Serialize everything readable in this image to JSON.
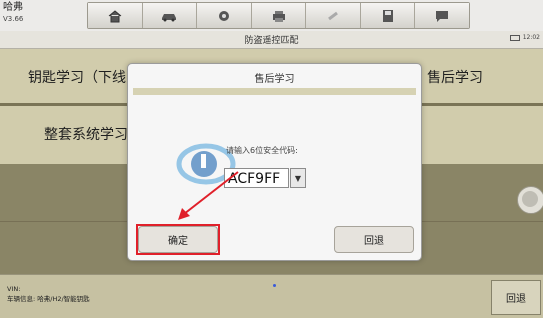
{
  "app": {
    "name": "哈弗",
    "version": "V3.66"
  },
  "toolbar": {
    "icons": [
      "home-icon",
      "vehicle-icon",
      "gear-icon",
      "print-icon",
      "link-icon",
      "save-icon",
      "chat-icon"
    ]
  },
  "header": {
    "title": "防盗遥控匹配",
    "time": "12:02"
  },
  "panels": {
    "key_learning": "钥匙学习（下线",
    "after_sales": "售后学习",
    "full_system": "整套系统学习"
  },
  "dialog": {
    "title": "售后学习",
    "prompt": "请输入6位安全代码:",
    "code_value": "ACF9FF",
    "ok_label": "确定",
    "cancel_label": "回退"
  },
  "footer": {
    "vin_label": "VIN:",
    "vehicle_info": "车辆信息: 哈弗/H2/智能钥匙",
    "back_label": "回退"
  },
  "colors": {
    "highlight": "#e0202a",
    "accent_dot": "#3a5bd9"
  }
}
